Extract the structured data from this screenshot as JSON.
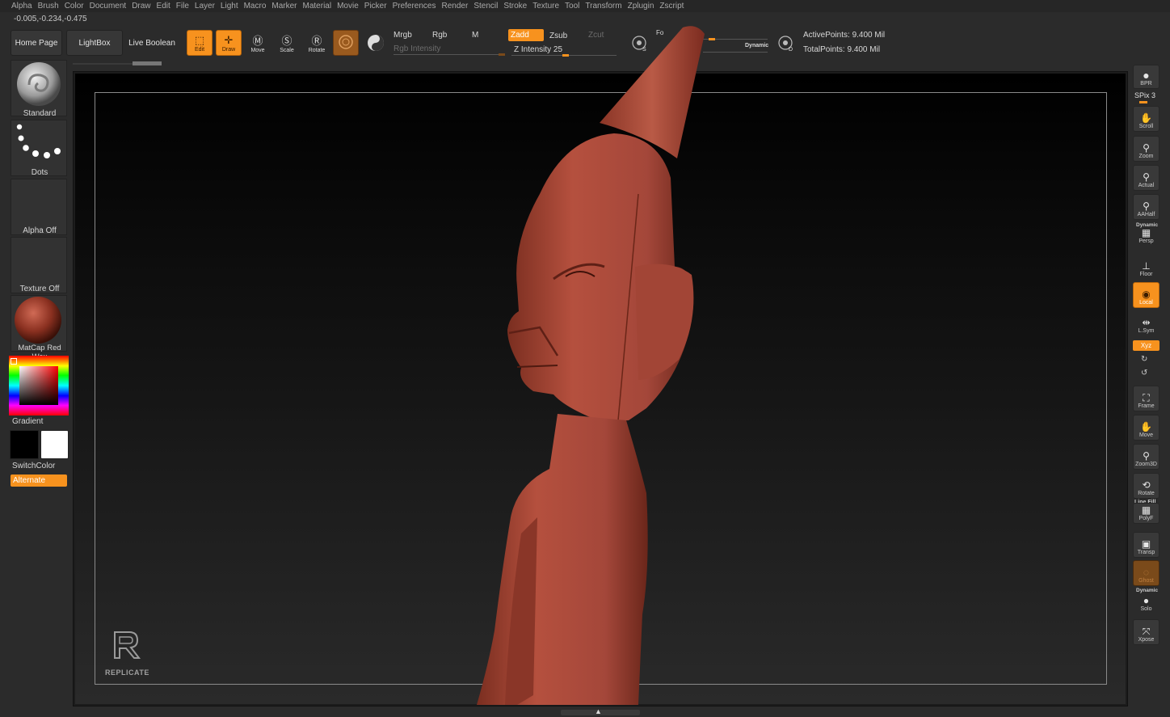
{
  "menu": [
    "Alpha",
    "Brush",
    "Color",
    "Document",
    "Draw",
    "Edit",
    "File",
    "Layer",
    "Light",
    "Macro",
    "Marker",
    "Material",
    "Movie",
    "Picker",
    "Preferences",
    "Render",
    "Stencil",
    "Stroke",
    "Texture",
    "Tool",
    "Transform",
    "Zplugin",
    "Zscript"
  ],
  "coords": "-0.005,-0.234,-0.475",
  "toolbar": {
    "home_page": "Home Page",
    "lightbox": "LightBox",
    "live_boolean": "Live Boolean",
    "edit": "Edit",
    "draw": "Draw",
    "move": "Move",
    "scale": "Scale",
    "rotate": "Rotate",
    "mrgb": "Mrgb",
    "rgb": "Rgb",
    "m": "M",
    "rgb_intensity": "Rgb Intensity",
    "zadd": "Zadd",
    "zsub": "Zsub",
    "zcut": "Zcut",
    "z_intensity": "Z Intensity 25",
    "focal_label": "Fo",
    "dynamic": "Dynamic",
    "active_points": "ActivePoints: 9.400 Mil",
    "total_points": "TotalPoints: 9.400 Mil"
  },
  "left": {
    "brush": "Standard",
    "stroke": "Dots",
    "alpha": "Alpha Off",
    "texture": "Texture Off",
    "material": "MatCap Red Wax",
    "gradient": "Gradient",
    "switch_color": "SwitchColor",
    "alternate": "Alternate"
  },
  "right": {
    "bpr": "BPR",
    "spix": "SPix 3",
    "scroll": "Scroll",
    "zoom": "Zoom",
    "actual": "Actual",
    "aahalf": "AAHalf",
    "dynamic_persp": "Dynamic",
    "persp": "Persp",
    "floor": "Floor",
    "local": "Local",
    "lsym": "L.Sym",
    "xyz": "Xyz",
    "frame": "Frame",
    "move": "Move",
    "zoom3d": "Zoom3D",
    "rotate": "Rotate",
    "line_fill": "Line Fill",
    "polyf": "PolyF",
    "transp": "Transp",
    "ghost": "Ghost",
    "dynamic_solo": "Dynamic",
    "solo": "Solo",
    "xpose": "Xpose"
  },
  "watermark": "REPLICATE",
  "colors": {
    "accent": "#f7921e",
    "model": "#b5503e"
  }
}
